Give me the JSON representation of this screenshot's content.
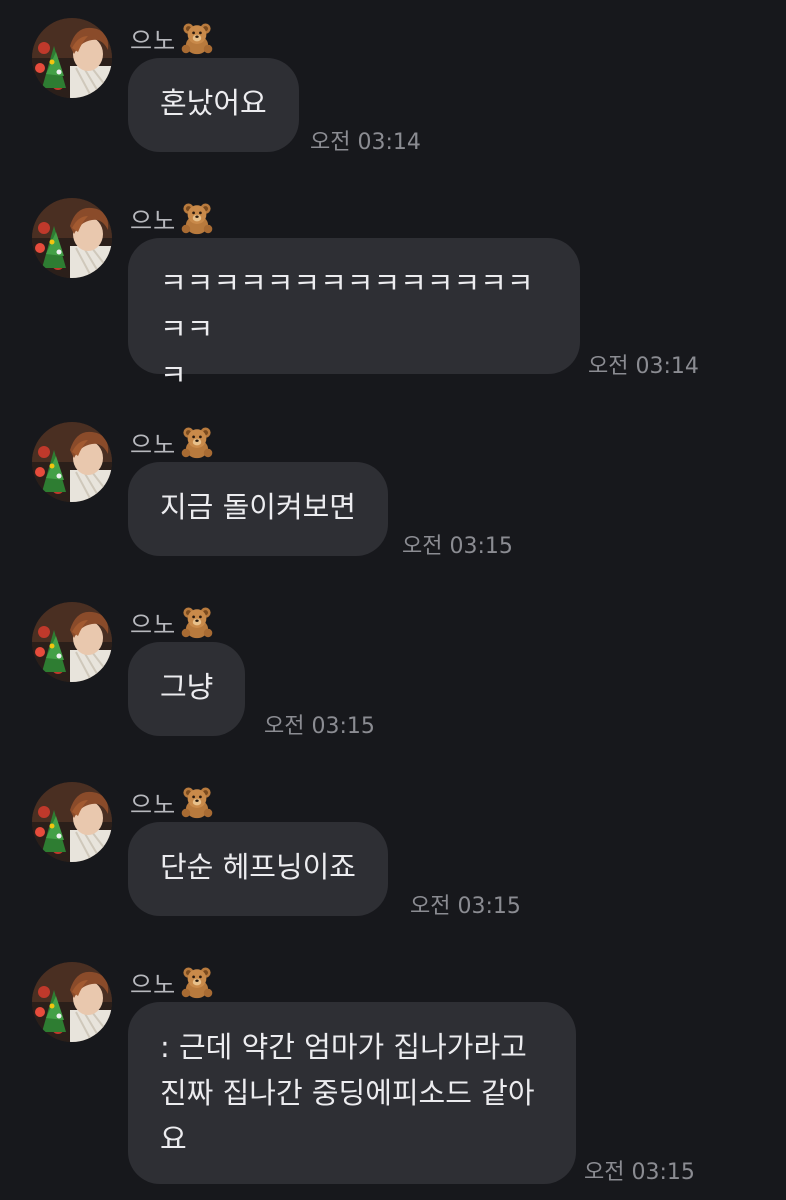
{
  "sender": {
    "name": "으노",
    "badge_icon": "teddy-bear-icon"
  },
  "colors": {
    "background": "#17181c",
    "bubble": "#2e2f34",
    "text": "#ececef",
    "time": "#8b8c92"
  },
  "messages": [
    {
      "text": "혼났어요",
      "time": "오전 03:14"
    },
    {
      "text": "ㅋㅋㅋㅋㅋㅋㅋㅋㅋㅋㅋㅋㅋㅋㅋㅋ\nㅋ",
      "time": "오전 03:14"
    },
    {
      "text": "지금 돌이켜보면",
      "time": "오전 03:15"
    },
    {
      "text": "그냥",
      "time": "오전 03:15"
    },
    {
      "text": "단순 헤프닝이죠",
      "time": "오전 03:15"
    },
    {
      "text": ": 근데 약간 엄마가 집나가라고\n진짜 집나간 중딩에피소드 같아\n요",
      "time": "오전 03:15"
    }
  ]
}
